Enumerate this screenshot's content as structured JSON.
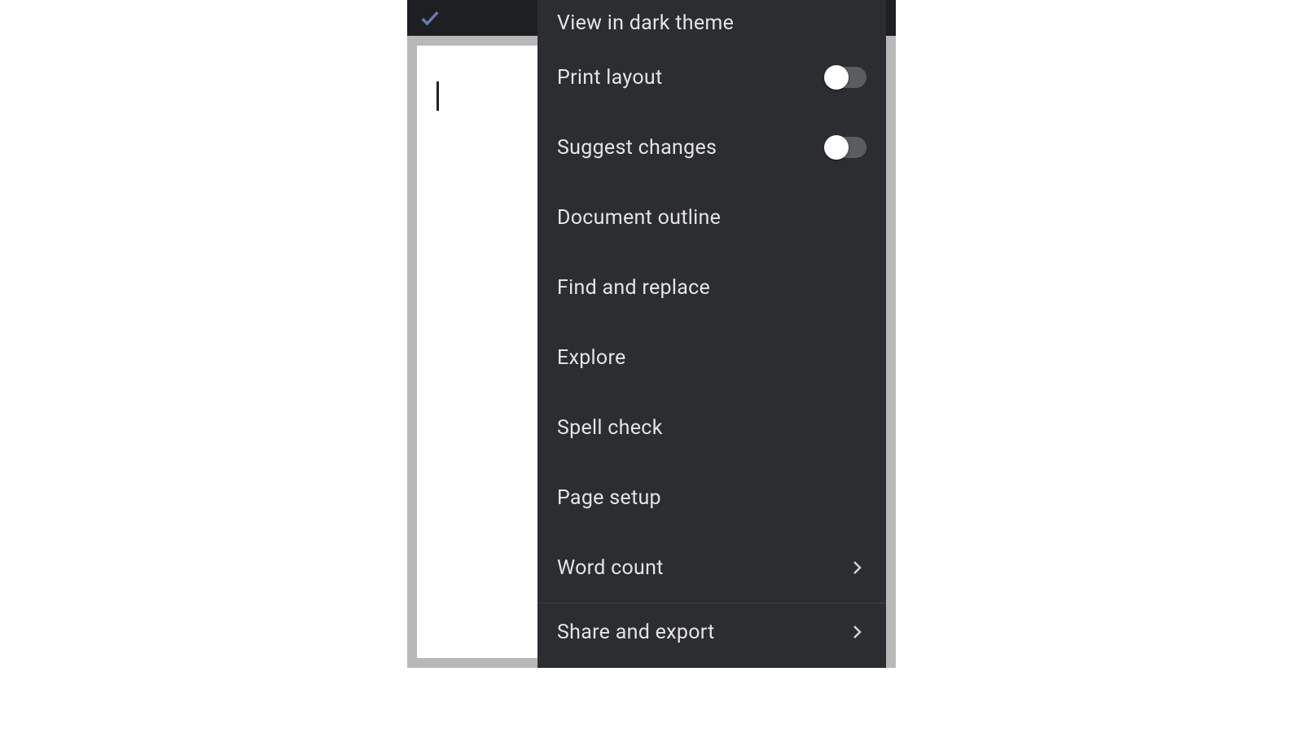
{
  "menu": {
    "items": [
      {
        "id": "view-dark-theme",
        "label": "View in dark theme",
        "type": "action"
      },
      {
        "id": "print-layout",
        "label": "Print layout",
        "type": "toggle",
        "on": false
      },
      {
        "id": "suggest-changes",
        "label": "Suggest changes",
        "type": "toggle",
        "on": false
      },
      {
        "id": "document-outline",
        "label": "Document outline",
        "type": "action"
      },
      {
        "id": "find-replace",
        "label": "Find and replace",
        "type": "action"
      },
      {
        "id": "explore",
        "label": "Explore",
        "type": "action"
      },
      {
        "id": "spell-check",
        "label": "Spell check",
        "type": "action"
      },
      {
        "id": "page-setup",
        "label": "Page setup",
        "type": "action"
      },
      {
        "id": "word-count",
        "label": "Word count",
        "type": "submenu"
      },
      {
        "id": "share-export",
        "label": "Share and export",
        "type": "submenu"
      }
    ]
  }
}
